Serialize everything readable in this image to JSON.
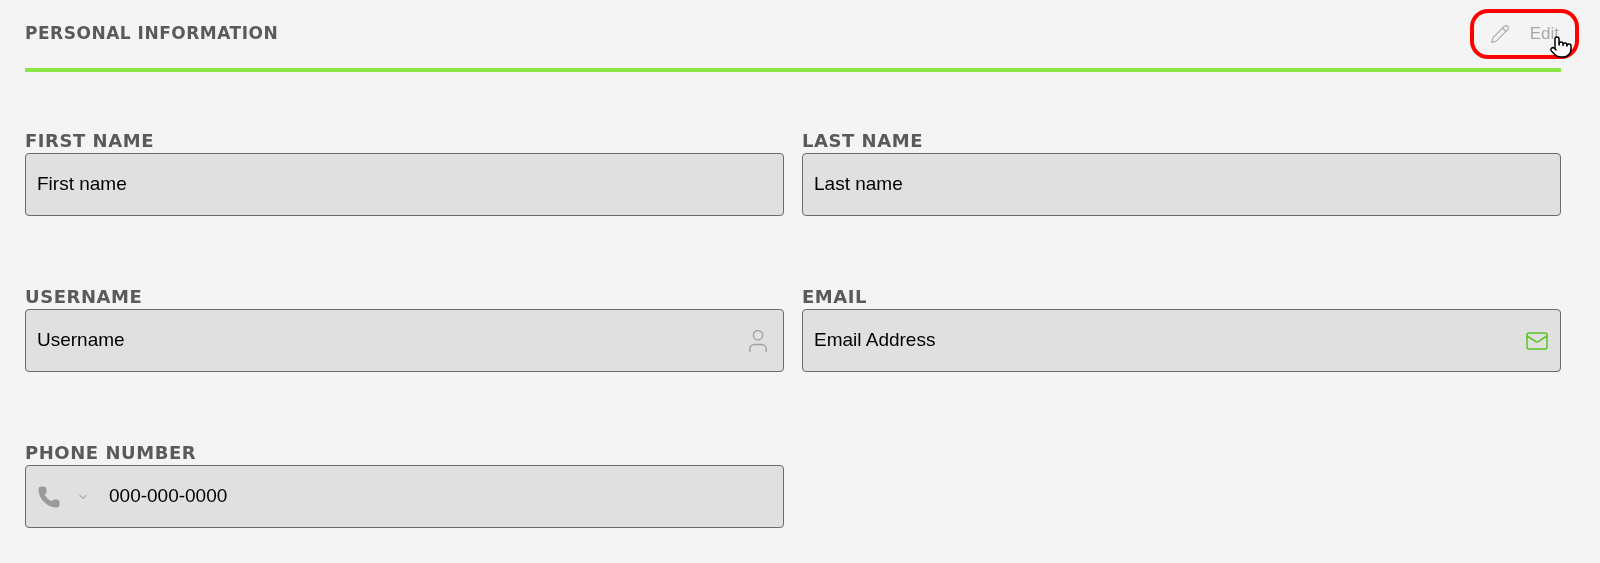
{
  "section": {
    "title": "PERSONAL INFORMATION",
    "edit_button": {
      "label": "Edit",
      "highlighted": true
    }
  },
  "rows": [
    [
      {
        "label": "FIRST NAME",
        "placeholder": "First name",
        "kind": "text"
      },
      {
        "label": "LAST NAME",
        "placeholder": "Last name",
        "kind": "text"
      }
    ],
    [
      {
        "label": "USERNAME",
        "placeholder": "Username",
        "kind": "user"
      },
      {
        "label": "EMAIL",
        "placeholder": "Email Address",
        "kind": "email"
      }
    ],
    [
      {
        "label": "PHONE NUMBER",
        "placeholder": "000-000-0000",
        "kind": "phone"
      }
    ]
  ]
}
